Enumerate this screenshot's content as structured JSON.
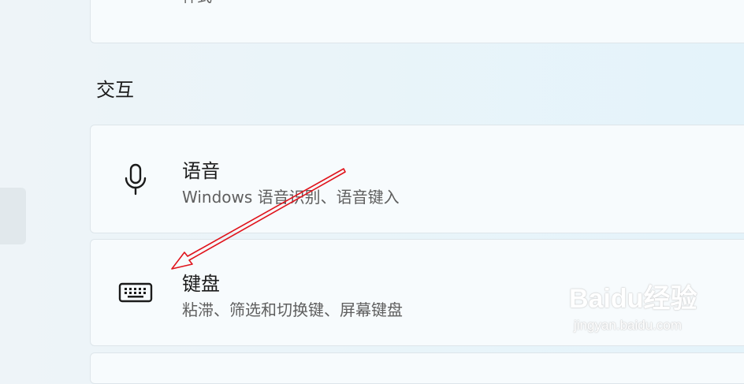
{
  "top_card": {
    "subtitle": "样式",
    "icon": "window-icon"
  },
  "section": {
    "heading": "交互"
  },
  "items": [
    {
      "title": "语音",
      "description": "Windows 语音识别、语音键入",
      "icon": "microphone-icon"
    },
    {
      "title": "键盘",
      "description": "粘滞、筛选和切换键、屏幕键盘",
      "icon": "keyboard-icon"
    }
  ],
  "annotation": {
    "arrow_color": "#e0141c"
  },
  "watermark": {
    "logo": "Baidu经验",
    "url": "jingyan.baidu.com"
  }
}
